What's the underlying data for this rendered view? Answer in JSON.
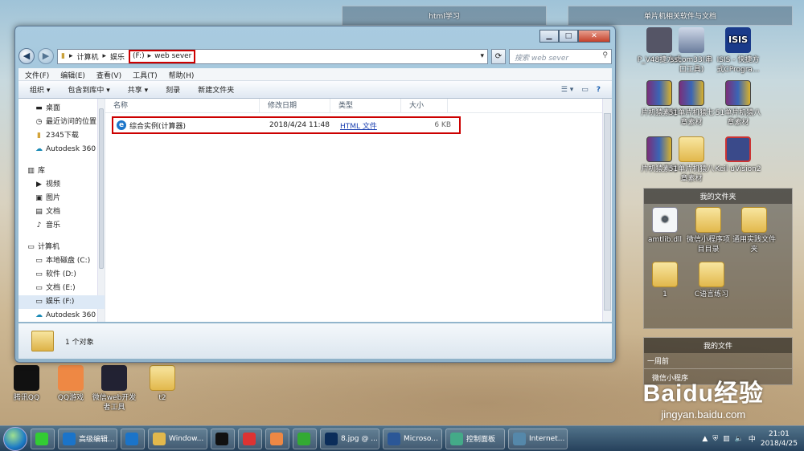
{
  "desktop_left": [
    {
      "label": "腾讯QQ",
      "icon": "qq-icon",
      "color": "#111"
    },
    {
      "label": "QQ游戏",
      "icon": "qq-game-icon",
      "color": "#e84"
    },
    {
      "label": "微信web开发者工具",
      "icon": "wechat-devtools-icon",
      "color": "#223"
    },
    {
      "label": "t2",
      "icon": "folder-icon",
      "color": "#e2b84c"
    }
  ],
  "panels": {
    "html": "html学习",
    "mcu": "单片机相关软件与文档"
  },
  "desktop_right_row1": [
    {
      "label": "P_V48捷方式",
      "icon": "shortcut-icon"
    },
    {
      "label": "sscom33(串口工具)",
      "icon": "building-icon"
    },
    {
      "label": "ISIS - 快捷方式CProgra...",
      "icon": "isis-icon"
    }
  ],
  "desktop_right_row2": [
    {
      "label": "片机猿素材",
      "icon": "rar-icon"
    },
    {
      "label": "51单片机猿七章素材",
      "icon": "rar-icon"
    },
    {
      "label": "51单片机猿八章素材",
      "icon": "rar-icon"
    }
  ],
  "desktop_right_row3": [
    {
      "label": "片机猿素材",
      "icon": "rar-icon"
    },
    {
      "label": "51单片机猿八章素材",
      "icon": "folder-icon"
    },
    {
      "label": "Keil uVision2",
      "icon": "keil-icon"
    }
  ],
  "myfiles_title": "我的文件夹",
  "myfiles": [
    {
      "label": "amtlib.dll",
      "icon": "dll-icon"
    },
    {
      "label": "微信小程序项目目录",
      "icon": "folder-icon"
    },
    {
      "label": "通用实践文件夹",
      "icon": "folder-icon"
    },
    {
      "label": "1",
      "icon": "folder-icon"
    },
    {
      "label": "C语言练习",
      "icon": "folder-icon"
    }
  ],
  "mydocs": {
    "title": "我的文件",
    "section": "一周前",
    "item": "微信小程序"
  },
  "explorer": {
    "breadcrumb": [
      "计算机",
      "娱乐",
      "(F:)",
      "web sever"
    ],
    "search_placeholder": "搜索 web sever",
    "menu": [
      "文件(F)",
      "编辑(E)",
      "查看(V)",
      "工具(T)",
      "帮助(H)"
    ],
    "toolbar": [
      "组织 ▾",
      "包含到库中 ▾",
      "共享 ▾",
      "刻录",
      "新建文件夹"
    ],
    "nav_favorites": [
      {
        "label": "桌面",
        "icon": "desktop-icon"
      },
      {
        "label": "最近访问的位置",
        "icon": "recent-icon"
      },
      {
        "label": "2345下载",
        "icon": "folder-icon"
      },
      {
        "label": "Autodesk 360",
        "icon": "cloud-icon"
      }
    ],
    "nav_library_title": "库",
    "nav_library": [
      {
        "label": "视频",
        "icon": "video-icon"
      },
      {
        "label": "图片",
        "icon": "picture-icon"
      },
      {
        "label": "文档",
        "icon": "document-icon"
      },
      {
        "label": "音乐",
        "icon": "music-icon"
      }
    ],
    "nav_computer_title": "计算机",
    "nav_computer": [
      {
        "label": "本地磁盘 (C:)",
        "icon": "drive-icon"
      },
      {
        "label": "软件 (D:)",
        "icon": "drive-icon"
      },
      {
        "label": "文档 (E:)",
        "icon": "drive-icon"
      },
      {
        "label": "娱乐 (F:)",
        "icon": "drive-icon"
      },
      {
        "label": "Autodesk 360",
        "icon": "cloud-icon"
      }
    ],
    "columns": [
      "名称",
      "修改日期",
      "类型",
      "大小"
    ],
    "file": {
      "name": "综合实例(计算器)",
      "date": "2018/4/24 11:48",
      "type": "HTML 文件",
      "size": "6 KB"
    },
    "status": "1 个对象"
  },
  "taskbar": [
    {
      "label": "",
      "icon": "iqiyi-icon",
      "color": "#3c3"
    },
    {
      "label": "高级编辑...",
      "icon": "ie-icon",
      "color": "#1b74c9"
    },
    {
      "label": "",
      "icon": "ie-icon",
      "color": "#1b74c9"
    },
    {
      "label": "Window...",
      "icon": "explorer-icon",
      "color": "#e2b84c"
    },
    {
      "label": "",
      "icon": "qq-icon",
      "color": "#111"
    },
    {
      "label": "",
      "icon": "chrome-icon",
      "color": "#d33"
    },
    {
      "label": "",
      "icon": "video-icon",
      "color": "#e84"
    },
    {
      "label": "",
      "icon": "player-icon",
      "color": "#3a3"
    },
    {
      "label": "8.jpg @ ...",
      "icon": "ps-icon",
      "color": "#0b2d5a"
    },
    {
      "label": "Microso...",
      "icon": "word-icon",
      "color": "#2b5797"
    },
    {
      "label": "控制面板",
      "icon": "control-panel-icon",
      "color": "#4a8"
    },
    {
      "label": "Internet...",
      "icon": "internet-icon",
      "color": "#58a"
    }
  ],
  "clock": {
    "time": "21:01",
    "date": "2018/4/25"
  },
  "watermark": {
    "brand": "Baidu经验",
    "url": "jingyan.baidu.com"
  }
}
